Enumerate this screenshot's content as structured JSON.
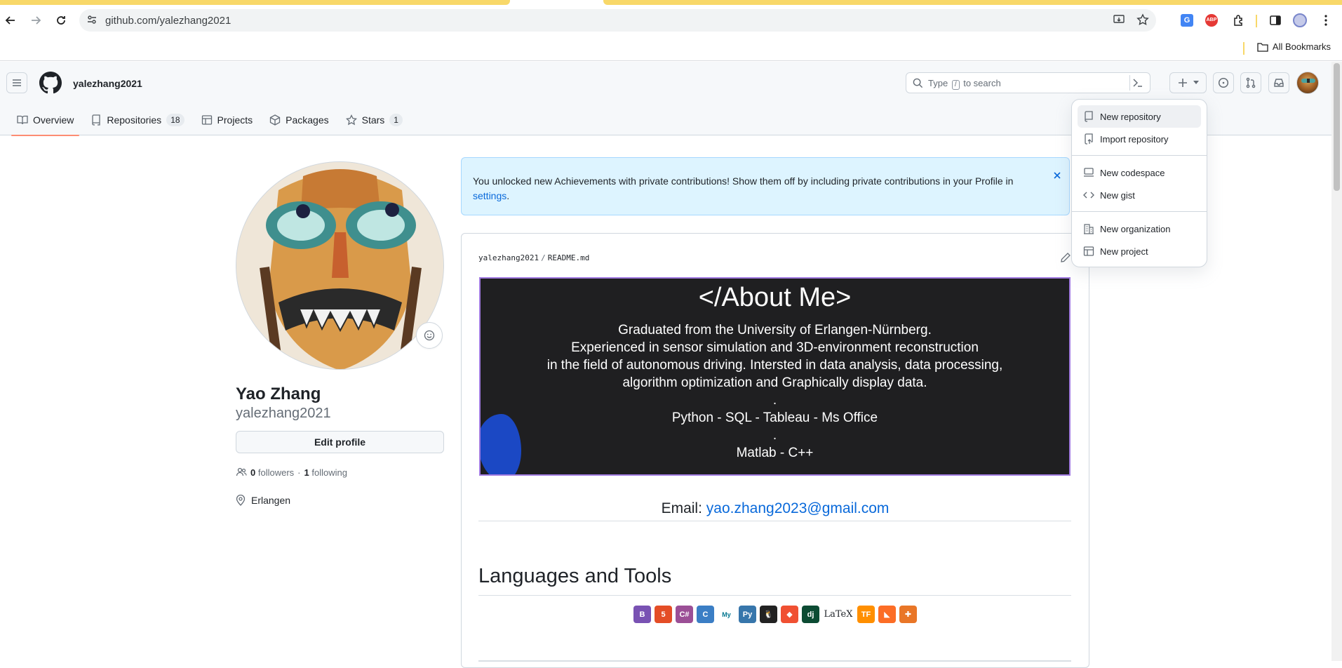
{
  "browser": {
    "url": "github.com/yalezhang2021",
    "bookmarks_label": "All Bookmarks"
  },
  "header": {
    "username": "yalezhang2021",
    "search_prefix": "Type",
    "search_key": "/",
    "search_suffix": "to search",
    "create_label": "+"
  },
  "tabs": [
    {
      "label": "Overview"
    },
    {
      "label": "Repositories",
      "count": "18"
    },
    {
      "label": "Projects"
    },
    {
      "label": "Packages"
    },
    {
      "label": "Stars",
      "count": "1"
    }
  ],
  "profile": {
    "name": "Yao Zhang",
    "login": "yalezhang2021",
    "edit_label": "Edit profile",
    "followers": "0",
    "followers_label": "followers",
    "dot": "·",
    "following": "1",
    "following_label": "following",
    "location": "Erlangen"
  },
  "flash": {
    "message": "You unlocked new Achievements with private contributions! Show them off by including private contributions in your Profile in",
    "link": "settings",
    "period": "."
  },
  "readme": {
    "owner": "yalezhang2021",
    "file": "README.md",
    "banner_title": "</About Me>",
    "banner_lines": [
      "Graduated from the University of  Erlangen-Nürnberg.",
      "Experienced in sensor simulation and 3D-environment reconstruction",
      "in the field of autonomous driving. Intersted in data analysis, data processing,",
      "algorithm optimization and Graphically display data.",
      ".",
      "Python - SQL - Tableau - Ms Office",
      ".",
      "Matlab - C++"
    ],
    "email_label": "Email:",
    "email": "yao.zhang2023@gmail.com",
    "languages_heading": "Languages and Tools",
    "tools": [
      {
        "name": "bootstrap",
        "text": "B",
        "color": "#7952b3"
      },
      {
        "name": "html5",
        "text": "5",
        "color": "#e44d26"
      },
      {
        "name": "csharp",
        "text": "C#",
        "color": "#9b4f96"
      },
      {
        "name": "c",
        "text": "C",
        "color": "#3b7ec5"
      },
      {
        "name": "mysql",
        "text": "My",
        "color": "#00758f"
      },
      {
        "name": "python",
        "text": "Py",
        "color": "#3776ab"
      },
      {
        "name": "linux",
        "text": "🐧",
        "color": "#222222"
      },
      {
        "name": "git",
        "text": "◆",
        "color": "#f05032"
      },
      {
        "name": "django",
        "text": "dj",
        "color": "#0c4b33"
      },
      {
        "name": "latex",
        "text": "LaTeX",
        "color": "#ffffff"
      },
      {
        "name": "tensorflow",
        "text": "TF",
        "color": "#ff8f00"
      },
      {
        "name": "gitlab",
        "text": "◣",
        "color": "#fc6d26"
      },
      {
        "name": "tableau",
        "text": "✚",
        "color": "#e97627"
      }
    ]
  },
  "menu": {
    "items": [
      {
        "label": "New repository",
        "icon": "repo-icon"
      },
      {
        "label": "Import repository",
        "icon": "repo-push-icon"
      },
      {
        "label": "New codespace",
        "icon": "codespaces-icon"
      },
      {
        "label": "New gist",
        "icon": "code-icon"
      },
      {
        "label": "New organization",
        "icon": "organization-icon"
      },
      {
        "label": "New project",
        "icon": "table-icon"
      }
    ]
  },
  "colors": {
    "accent": "#0969da",
    "tab_underline": "#fd8c73",
    "flash_bg": "#ddf4ff",
    "banner_bg": "#1f1f21",
    "browser_theme": "#f8d869"
  }
}
